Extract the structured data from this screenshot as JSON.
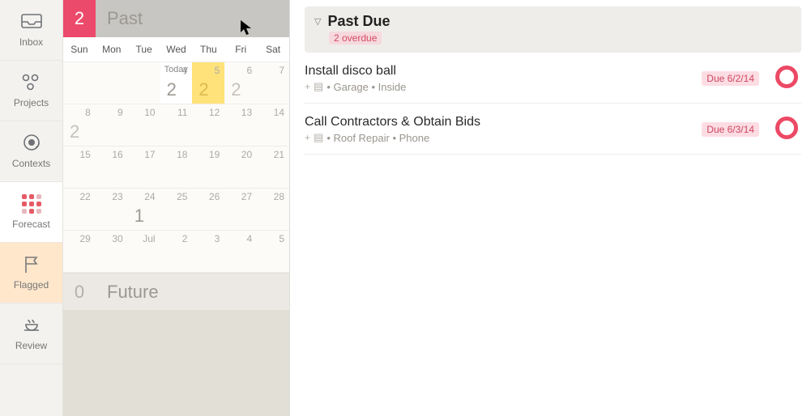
{
  "nav": [
    {
      "id": "inbox",
      "label": "Inbox"
    },
    {
      "id": "projects",
      "label": "Projects"
    },
    {
      "id": "contexts",
      "label": "Contexts"
    },
    {
      "id": "forecast",
      "label": "Forecast"
    },
    {
      "id": "flagged",
      "label": "Flagged"
    },
    {
      "id": "review",
      "label": "Review"
    }
  ],
  "active_nav": "forecast",
  "past": {
    "count": "2",
    "label": "Past"
  },
  "future": {
    "count": "0",
    "label": "Future"
  },
  "weekdays": [
    "Sun",
    "Mon",
    "Tue",
    "Wed",
    "Thu",
    "Fri",
    "Sat"
  ],
  "weeks": [
    [
      {
        "n": ""
      },
      {
        "n": ""
      },
      {
        "n": ""
      },
      {
        "n": "4",
        "today": true,
        "big": "2",
        "label": "Today"
      },
      {
        "n": "5",
        "big": "2",
        "hl": true
      },
      {
        "n": "6",
        "big": "2",
        "faint": true
      },
      {
        "n": "7"
      }
    ],
    [
      {
        "n": "8",
        "big": "2",
        "faint": true
      },
      {
        "n": "9"
      },
      {
        "n": "10"
      },
      {
        "n": "11"
      },
      {
        "n": "12"
      },
      {
        "n": "13"
      },
      {
        "n": "14"
      }
    ],
    [
      {
        "n": "15"
      },
      {
        "n": "16"
      },
      {
        "n": "17"
      },
      {
        "n": "18"
      },
      {
        "n": "19"
      },
      {
        "n": "20"
      },
      {
        "n": "21"
      }
    ],
    [
      {
        "n": "22"
      },
      {
        "n": "23"
      },
      {
        "n": "24",
        "big": "1"
      },
      {
        "n": "25"
      },
      {
        "n": "26"
      },
      {
        "n": "27"
      },
      {
        "n": "28"
      }
    ],
    [
      {
        "n": "29"
      },
      {
        "n": "30"
      },
      {
        "n": "Jul"
      },
      {
        "n": "2"
      },
      {
        "n": "3"
      },
      {
        "n": "4"
      },
      {
        "n": "5"
      }
    ]
  ],
  "past_due": {
    "title": "Past Due",
    "badge": "2 overdue",
    "tasks": [
      {
        "title": "Install disco ball",
        "project": "Garage",
        "context": "Inside",
        "due": "Due 6/2/14"
      },
      {
        "title": "Call Contractors & Obtain Bids",
        "project": "Roof Repair",
        "context": "Phone",
        "due": "Due 6/3/14"
      }
    ]
  }
}
